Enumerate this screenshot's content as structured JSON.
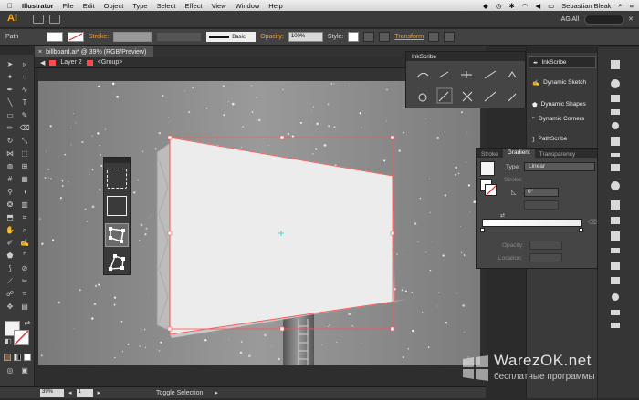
{
  "menubar": {
    "app_name": "Illustrator",
    "items": [
      "File",
      "Edit",
      "Object",
      "Type",
      "Select",
      "Effect",
      "View",
      "Window",
      "Help"
    ],
    "user": "Sebastian Bleak"
  },
  "appbar": {
    "logo": "Ai",
    "workspace": "AG All"
  },
  "control_bar": {
    "selection_label": "Path",
    "stroke_label": "Stroke:",
    "stroke_profile": "Basic",
    "opacity_label": "Opacity:",
    "opacity_value": "100%",
    "style_label": "Style:",
    "transform_label": "Transform"
  },
  "document": {
    "tab_title": "billboard.ai* @ 39% (RGB/Preview)",
    "layer_label": "Layer 2",
    "group_label": "<Group>"
  },
  "status_bar": {
    "zoom": "39%",
    "artboard": "1",
    "toggle_label": "Toggle Selection"
  },
  "inkscribe_panel": {
    "title": "InkScribe"
  },
  "right_panel": {
    "items": [
      "InkScribe",
      "Dynamic Sketch",
      "Dynamic Shapes",
      "Dynamic Corners",
      "PathScribe"
    ]
  },
  "gradient_panel": {
    "tabs": [
      "Stroke",
      "Gradient",
      "Transparency"
    ],
    "type_label": "Type:",
    "type_value": "Linear",
    "stroke_label": "Stroke:",
    "angle_value": "0°",
    "opacity_label": "Opacity:",
    "location_label": "Location:"
  },
  "watermark": {
    "title": "WarezOK.net",
    "subtitle": "бесплатные программы"
  },
  "colors": {
    "accent": "#f7a51b",
    "selection": "#ff4b4b",
    "panel_bg": "#454545"
  }
}
